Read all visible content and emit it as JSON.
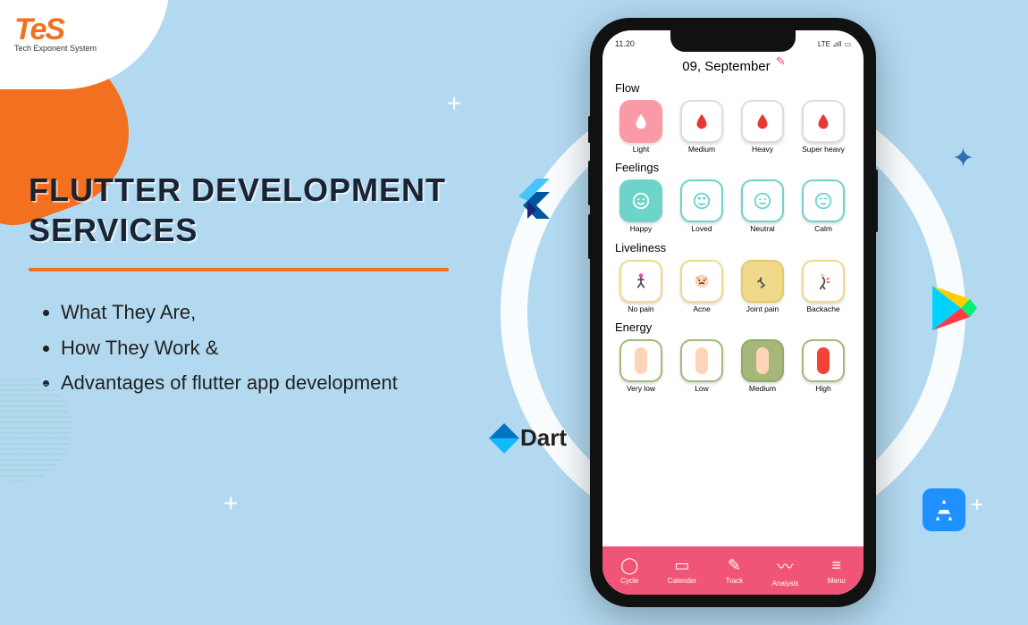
{
  "logo": {
    "brand": "TeS",
    "subtitle": "Tech Exponent System"
  },
  "headline": {
    "line1": "FLUTTER DEVELOPMENT",
    "line2": "SERVICES"
  },
  "bullets": [
    "What They Are,",
    "How They Work &",
    "Advantages of flutter app development"
  ],
  "tech": {
    "dart_label": "Dart"
  },
  "phone": {
    "status": {
      "time": "11.20",
      "net": "LTE ⊿ll",
      "batt": "▭"
    },
    "date": "09, September",
    "sections": [
      {
        "title": "Flow",
        "tiles": [
          {
            "label": "Light",
            "variant": "pink",
            "glyph": "droplet-icon"
          },
          {
            "label": "Medium",
            "variant": "drop",
            "glyph": "droplet-icon"
          },
          {
            "label": "Heavy",
            "variant": "drop",
            "glyph": "droplet-icon"
          },
          {
            "label": "Super heavy",
            "variant": "drop",
            "glyph": "droplet-icon"
          }
        ]
      },
      {
        "title": "Feelings",
        "tiles": [
          {
            "label": "Happy",
            "variant": "teal",
            "glyph": "smile-icon"
          },
          {
            "label": "Loved",
            "variant": "teal-outline",
            "glyph": "hearts-eyes-icon"
          },
          {
            "label": "Neutral",
            "variant": "teal-outline",
            "glyph": "neutral-face-icon"
          },
          {
            "label": "Calm",
            "variant": "teal-outline",
            "glyph": "calm-face-icon"
          }
        ]
      },
      {
        "title": "Liveliness",
        "tiles": [
          {
            "label": "No pain",
            "variant": "yellow-outline",
            "glyph": "jump-person-icon"
          },
          {
            "label": "Acne",
            "variant": "yellow-outline",
            "glyph": "acne-face-icon"
          },
          {
            "label": "Joint pain",
            "variant": "yellow",
            "glyph": "kneel-person-icon"
          },
          {
            "label": "Backache",
            "variant": "yellow-outline",
            "glyph": "back-pain-icon"
          }
        ]
      },
      {
        "title": "Energy",
        "tiles": [
          {
            "label": "Very low",
            "variant": "green-outline",
            "glyph": "body-flesh-icon"
          },
          {
            "label": "Low",
            "variant": "green-outline",
            "glyph": "body-flesh-icon"
          },
          {
            "label": "Medium",
            "variant": "green",
            "glyph": "body-flesh-icon"
          },
          {
            "label": "High",
            "variant": "green-outline",
            "glyph": "body-red-icon"
          }
        ]
      }
    ],
    "nav": [
      {
        "label": "Cycle",
        "icon": "cycle-icon"
      },
      {
        "label": "Calender",
        "icon": "calendar-icon"
      },
      {
        "label": "Track",
        "icon": "track-icon"
      },
      {
        "label": "Analysis",
        "icon": "analysis-icon"
      },
      {
        "label": "Menu",
        "icon": "menu-icon"
      }
    ]
  }
}
